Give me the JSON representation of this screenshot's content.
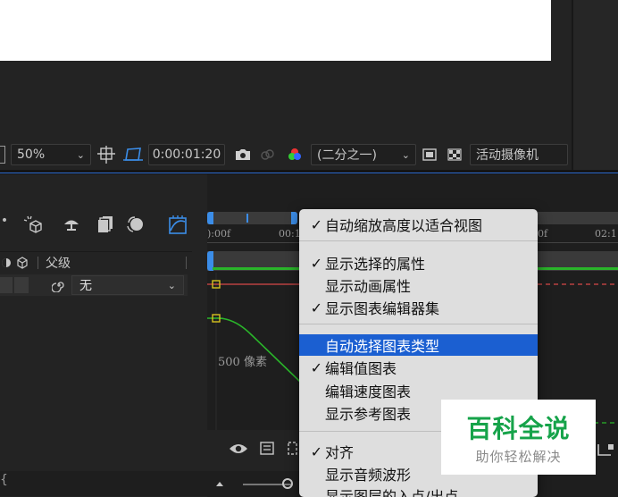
{
  "viewer_toolbar": {
    "zoom_value": "50%",
    "timecode": "0:00:01:20",
    "resolution_value": "(二分之一)",
    "camera_value": "活动摄像机"
  },
  "timeline": {
    "parent_header": "父级",
    "parent_value": "无",
    "ruler_start": "):00f",
    "ruler_mid": "00:1",
    "ruler_end_a": "0f",
    "ruler_end_b": "02:1",
    "graph_axis_label": "500 像素"
  },
  "context_menu": {
    "items": [
      {
        "label": "自动缩放高度以适合视图",
        "checked": "✓"
      },
      {
        "label": "显示选择的属性",
        "checked": "✓"
      },
      {
        "label": "显示动画属性",
        "checked": ""
      },
      {
        "label": "显示图表编辑器集",
        "checked": "✓"
      },
      {
        "label": "自动选择图表类型",
        "checked": "",
        "selected": true
      },
      {
        "label": "编辑值图表",
        "checked": "✓"
      },
      {
        "label": "编辑速度图表",
        "checked": ""
      },
      {
        "label": "显示参考图表",
        "checked": ""
      },
      {
        "label": "对齐",
        "checked": "✓"
      },
      {
        "label": "显示音频波形",
        "checked": ""
      },
      {
        "label": "显示图层的入点/出点",
        "checked": ""
      }
    ]
  },
  "watermark": {
    "title": "百科全说",
    "subtitle": "助你轻松解决"
  },
  "colors": {
    "accent_blue": "#1b5fd1",
    "graph_green": "#2ab52a",
    "graph_red": "#d84848",
    "keyframe_yellow": "#d6c21e",
    "watermark_green": "#16a34a"
  }
}
